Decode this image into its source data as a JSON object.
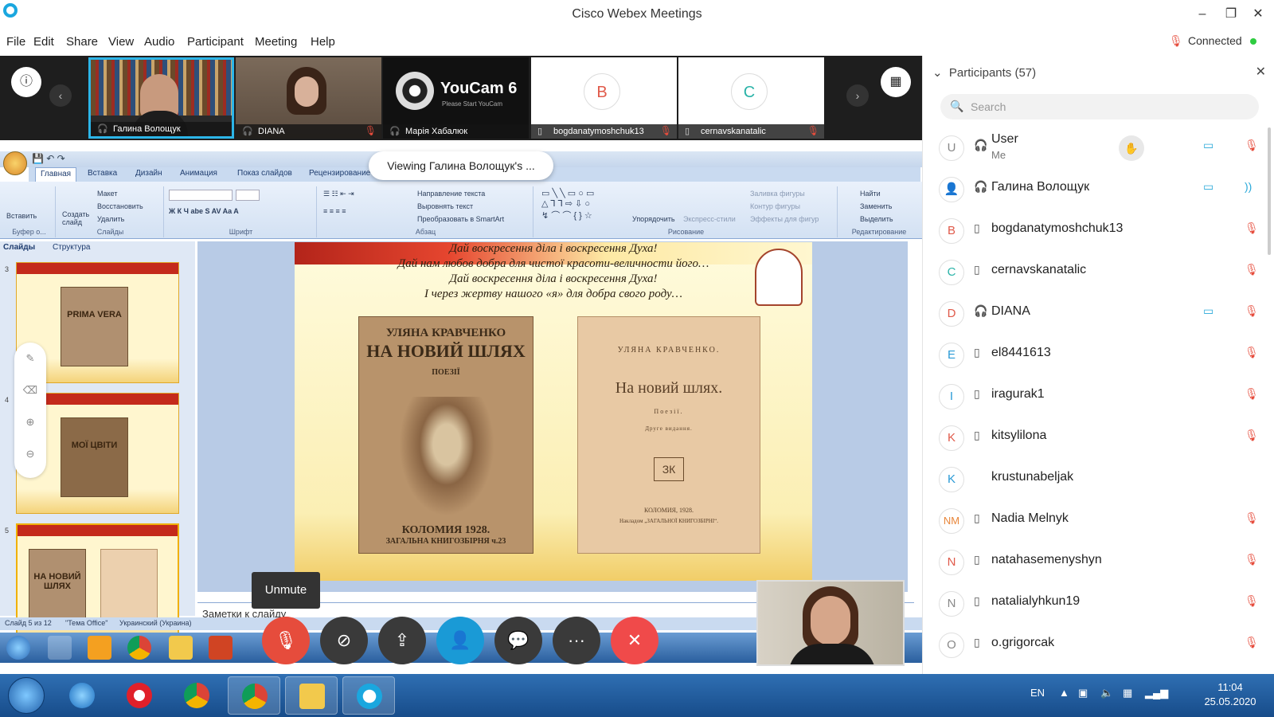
{
  "window": {
    "title": "Cisco Webex Meetings",
    "minimize": "–",
    "maximize": "❐",
    "close": "✕"
  },
  "menu": [
    "File",
    "Edit",
    "Share",
    "View",
    "Audio",
    "Participant",
    "Meeting",
    "Help"
  ],
  "status": {
    "connected": "Connected"
  },
  "video_strip": {
    "tiles": [
      {
        "name": "Галина Волощук",
        "type": "video",
        "muted": false,
        "active": true
      },
      {
        "name": "DIANA",
        "type": "video",
        "muted": true,
        "active": false
      },
      {
        "name": "Марія Хабалюк",
        "type": "youcam",
        "muted": false,
        "active": false
      },
      {
        "name": "bogdanatymoshchuk13",
        "type": "avatar",
        "initial": "B",
        "color": "#e05a4a",
        "muted": true
      },
      {
        "name": "cernavskanatalic",
        "type": "avatar",
        "initial": "C",
        "color": "#2ab3a8",
        "muted": true
      }
    ],
    "youcam_label": "YouCam 6",
    "youcam_sub": "Please Start YouCam"
  },
  "share": {
    "viewing_label": "Viewing Галина Волощук's ...",
    "ppt_tabs": [
      "Главная",
      "Вставка",
      "Дизайн",
      "Анимация",
      "Показ слайдов",
      "Рецензирование"
    ],
    "ribbon_groups": [
      "Буфер о...",
      "Слайды",
      "Шрифт",
      "Абзац",
      "Рисование",
      "Редактирование"
    ],
    "ribbon_items": {
      "paste": "Вставить",
      "new_slide": "Создать слайд",
      "layout": "Макет",
      "reset": "Восстановить",
      "delete": "Удалить",
      "text_dir": "Направление текста",
      "align_text": "Выровнять текст",
      "smartart": "Преобразовать в SmartArt",
      "arrange": "Упорядочить",
      "quick_styles": "Экспресс-стили",
      "fill": "Заливка фигуры",
      "outline": "Контур фигуры",
      "effects": "Эффекты для фигур",
      "find": "Найти",
      "replace": "Заменить",
      "select": "Выделить"
    },
    "thumb_tabs": [
      "Слайды",
      "Структура"
    ],
    "thumbs": [
      {
        "num": "3",
        "title": "PRIMA VERA"
      },
      {
        "num": "4",
        "title": "МОЇ ЦВІТИ"
      },
      {
        "num": "5",
        "title": "НА НОВИЙ ШЛЯХ"
      }
    ],
    "slide_lines": [
      "Дай воскресення ділa і воскресення Духа!",
      "Дай нам любов добра для чистої красоти-величности його…",
      "Дай воскресення ділa і воскресення Духа!",
      "І через жертву нашого «я» для добра свого роду…"
    ],
    "book1": {
      "author": "УЛЯНА КРАВЧЕНКО",
      "title": "НА НОВИЙ ШЛЯХ",
      "genre": "ПОЕЗІЇ",
      "footer": "КОЛОМИЯ 1928.",
      "footer2": "ЗАГАЛЬНА КНИГОЗБІРНЯ ч.23"
    },
    "book2": {
      "author": "УЛЯНА КРАВЧЕНКО.",
      "title": "На новий шлях.",
      "genre": "Поезії.",
      "edition": "Друге видання.",
      "mark": "ЗК",
      "footer": "КОЛОМИЯ, 1928.",
      "footer2": "Накладом „ЗАГАЛЬНОЇ КНИГОЗБІРНІ“."
    },
    "notes_placeholder": "Заметки к слайду",
    "ppt_status": {
      "slide": "Слайд 5 из 12",
      "theme": "\"Тема Office\"",
      "lang": "Украинский (Украина)"
    }
  },
  "controls": {
    "unmute_tooltip": "Unmute",
    "buttons": [
      {
        "name": "mute",
        "glyph": "🎙",
        "color": "#e64c3c"
      },
      {
        "name": "video",
        "glyph": "⊘",
        "color": "#3a3a3a"
      },
      {
        "name": "share",
        "glyph": "⇪",
        "color": "#3a3a3a"
      },
      {
        "name": "participants",
        "glyph": "👤",
        "color": "#1a9ad6"
      },
      {
        "name": "chat",
        "glyph": "💬",
        "color": "#3a3a3a"
      },
      {
        "name": "more",
        "glyph": "···",
        "color": "#3a3a3a"
      },
      {
        "name": "leave",
        "glyph": "✕",
        "color": "#f04a4a"
      }
    ]
  },
  "participants_panel": {
    "title": "Participants (57)",
    "search_placeholder": "Search",
    "rows": [
      {
        "initial": "U",
        "color": "#888888",
        "name": "User",
        "sub": "Me",
        "device": "headset",
        "raise": true,
        "video": true,
        "mic": "muted"
      },
      {
        "initial": "👤",
        "color": "#555555",
        "name": "Галина Волощук",
        "device": "headset",
        "video": true,
        "mic": "speaking"
      },
      {
        "initial": "B",
        "color": "#e05a4a",
        "name": "bogdanatymoshchuk13",
        "device": "phone",
        "mic": "muted"
      },
      {
        "initial": "C",
        "color": "#2ab3a8",
        "name": "cernavskanatalic",
        "device": "phone",
        "mic": "muted"
      },
      {
        "initial": "D",
        "color": "#e05a4a",
        "name": "DIANA",
        "device": "headset",
        "video": true,
        "mic": "muted"
      },
      {
        "initial": "E",
        "color": "#2a9ad6",
        "name": "el8441613",
        "device": "phone",
        "mic": "muted"
      },
      {
        "initial": "I",
        "color": "#2a9ad6",
        "name": "iragurak1",
        "device": "phone",
        "mic": "muted"
      },
      {
        "initial": "K",
        "color": "#e05a4a",
        "name": "kitsylilona",
        "device": "phone",
        "mic": "muted"
      },
      {
        "initial": "K",
        "color": "#2a9ad6",
        "name": "krustunabeljak",
        "device": "",
        "mic": ""
      },
      {
        "initial": "NM",
        "color": "#e8863a",
        "name": "Nadia Melnyk",
        "device": "phone",
        "mic": "muted"
      },
      {
        "initial": "N",
        "color": "#e05a4a",
        "name": "natahasemenyshyn",
        "device": "phone",
        "mic": "muted"
      },
      {
        "initial": "N",
        "color": "#888888",
        "name": "natalialyhkun19",
        "device": "phone",
        "mic": "muted"
      },
      {
        "initial": "O",
        "color": "#888888",
        "name": "o.grigorcak",
        "device": "phone",
        "mic": "muted"
      }
    ]
  },
  "taskbar": {
    "lang": "EN",
    "time": "11:04",
    "date": "25.05.2020"
  }
}
